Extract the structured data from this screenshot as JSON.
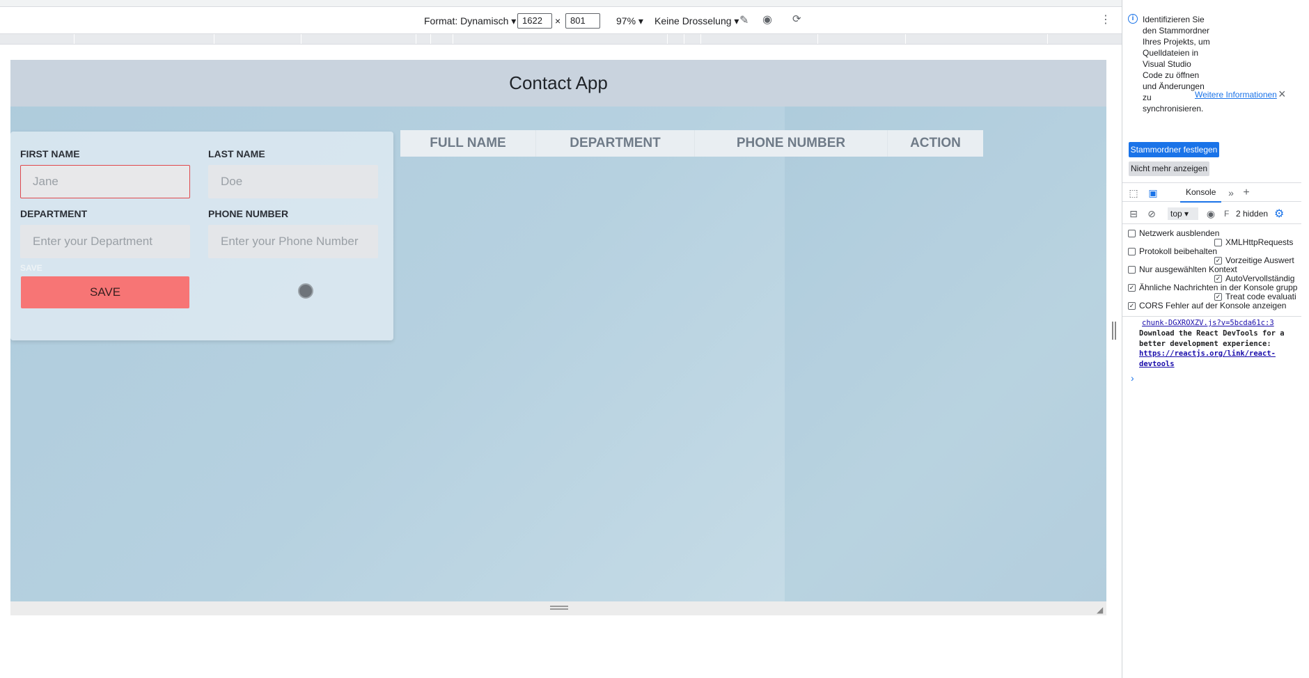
{
  "devtools_toolbar": {
    "format_label": "Format: Dynamisch",
    "width_value": "1622",
    "times": "×",
    "height_value": "801",
    "zoom": "97%",
    "throttle": "Keine Drosselung"
  },
  "app": {
    "title": "Contact App",
    "form": {
      "first_name_label": "FIRST NAME",
      "first_name_placeholder": "Jane",
      "last_name_label": "LAST NAME",
      "last_name_placeholder": "Doe",
      "department_label": "DEPARTMENT",
      "department_placeholder": "Enter your Department",
      "phone_label": "PHONE NUMBER",
      "phone_placeholder": "Enter your Phone Number",
      "save_small_label": "SAVE",
      "save_button": "SAVE"
    },
    "table_headers": [
      "FULL NAME",
      "DEPARTMENT",
      "PHONE NUMBER",
      "ACTION"
    ]
  },
  "devtools_panel": {
    "info_text": "Identifizieren Sie den Stammordner Ihres Projekts, um Quelldateien in Visual Studio Code zu öffnen und Änderungen zu synchronisieren.",
    "info_link": "Weitere Informationen",
    "set_root_button": "Stammordner festlegen",
    "dont_show_button": "Nicht mehr anzeigen",
    "console_tab": "Konsole",
    "context_select": "top",
    "filter_letter": "F",
    "hidden_count": "2 hidden",
    "settings": [
      {
        "label": "Netzwerk ausblenden",
        "checked": false
      },
      {
        "label": "Protokoll beibehalten",
        "checked": false
      },
      {
        "label": "Nur ausgewählten Kontext",
        "checked": false
      },
      {
        "label": "Ähnliche Nachrichten in der Konsole grupp",
        "checked": true
      },
      {
        "label": "CORS Fehler auf der Konsole anzeigen",
        "checked": true
      }
    ],
    "settings_right": [
      {
        "label": "XMLHttpRequests",
        "checked": false
      },
      {
        "label": "Vorzeitige Auswert",
        "checked": true
      },
      {
        "label": "AutoVervollständig",
        "checked": true
      },
      {
        "label": "Treat code evaluati",
        "checked": true
      }
    ],
    "console_source": "chunk-DGXROXZV.js?v=5bcda61c:3",
    "console_message": "Download the React DevTools for a better development experience: ",
    "console_url": "https://reactjs.org/link/react-devtools"
  }
}
